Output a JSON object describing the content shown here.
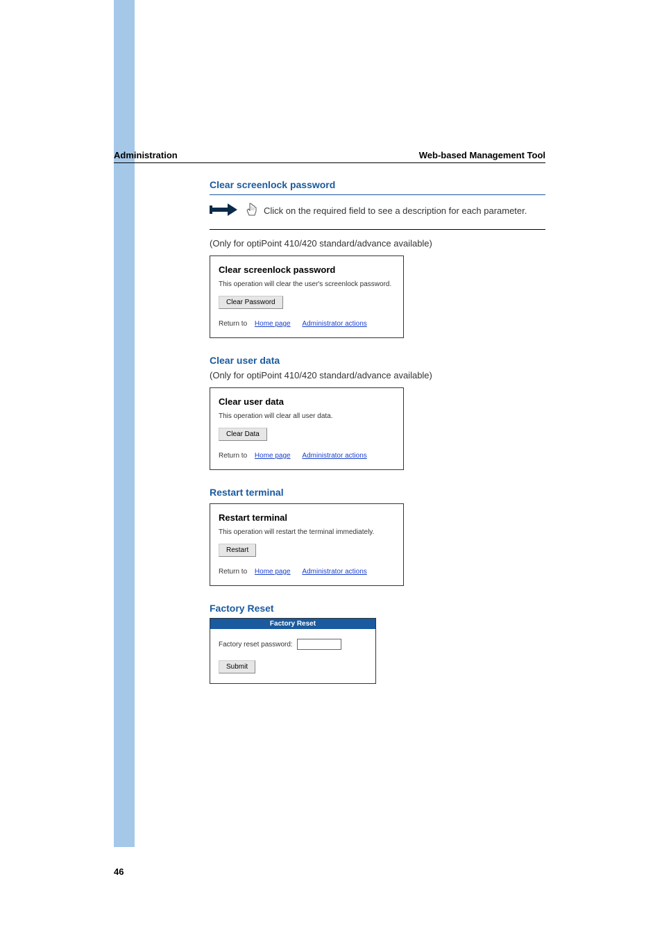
{
  "header": {
    "left": "Administration",
    "right": "Web-based Management Tool"
  },
  "section1": {
    "heading": "Clear screenlock password",
    "arrowNote": "Click on the required field to see a description for each parameter.",
    "availability": "(Only for optiPoint 410/420 standard/advance available)",
    "panel": {
      "title": "Clear screenlock password",
      "desc": "This operation will clear the user's screenlock password.",
      "button": "Clear Password",
      "returnTo": "Return to",
      "homePage": "Home page",
      "adminActions": "Administrator actions"
    }
  },
  "section2": {
    "heading": "Clear user data",
    "availability": "(Only for optiPoint 410/420 standard/advance available)",
    "panel": {
      "title": "Clear user data",
      "desc": "This operation will clear all user data.",
      "button": "Clear Data",
      "returnTo": "Return to",
      "homePage": "Home page",
      "adminActions": "Administrator actions"
    }
  },
  "section3": {
    "heading": "Restart terminal",
    "panel": {
      "title": "Restart terminal",
      "desc": "This operation will restart the terminal immediately.",
      "button": "Restart",
      "returnTo": "Return to",
      "homePage": "Home page",
      "adminActions": "Administrator actions"
    }
  },
  "section4": {
    "heading": "Factory Reset",
    "panel": {
      "headerTitle": "Factory Reset",
      "label": "Factory reset password:",
      "button": "Submit"
    }
  },
  "pageNumber": "46"
}
